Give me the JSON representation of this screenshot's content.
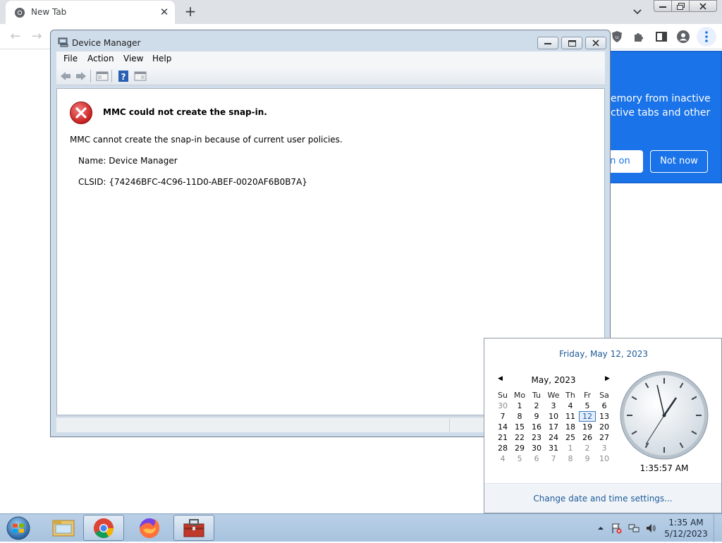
{
  "browser": {
    "tab_title": "New Tab",
    "promo": {
      "line1": "emory from inactive",
      "line2": "ctive tabs and other",
      "turn_on_label": "rn on",
      "not_now_label": "Not now"
    },
    "accent_color": "#1a73e8"
  },
  "device_manager": {
    "title": "Device Manager",
    "menu": [
      "File",
      "Action",
      "View",
      "Help"
    ],
    "error": {
      "title": "MMC could not create the snap-in.",
      "message": "MMC cannot create the snap-in because of current user policies.",
      "name_line": "Name: Device Manager",
      "clsid_line": "CLSID: {74246BFC-4C96-11D0-ABEF-0020AF6B0B7A}"
    }
  },
  "calendar": {
    "full_date": "Friday, May 12, 2023",
    "month_label": "May, 2023",
    "weekdays": [
      "Su",
      "Mo",
      "Tu",
      "We",
      "Th",
      "Fr",
      "Sa"
    ],
    "weeks": [
      [
        "30",
        "1",
        "2",
        "3",
        "4",
        "5",
        "6"
      ],
      [
        "7",
        "8",
        "9",
        "10",
        "11",
        "12",
        "13"
      ],
      [
        "14",
        "15",
        "16",
        "17",
        "18",
        "19",
        "20"
      ],
      [
        "21",
        "22",
        "23",
        "24",
        "25",
        "26",
        "27"
      ],
      [
        "28",
        "29",
        "30",
        "31",
        "1",
        "2",
        "3"
      ],
      [
        "4",
        "5",
        "6",
        "7",
        "8",
        "9",
        "10"
      ]
    ],
    "today": "12",
    "clock_time": "1:35:57 AM",
    "settings_link": "Change date and time settings..."
  },
  "taskbar": {
    "time": "1:35 AM",
    "date": "5/12/2023",
    "apps": [
      "windows-explorer",
      "google-chrome",
      "firefox",
      "toolbox"
    ]
  }
}
